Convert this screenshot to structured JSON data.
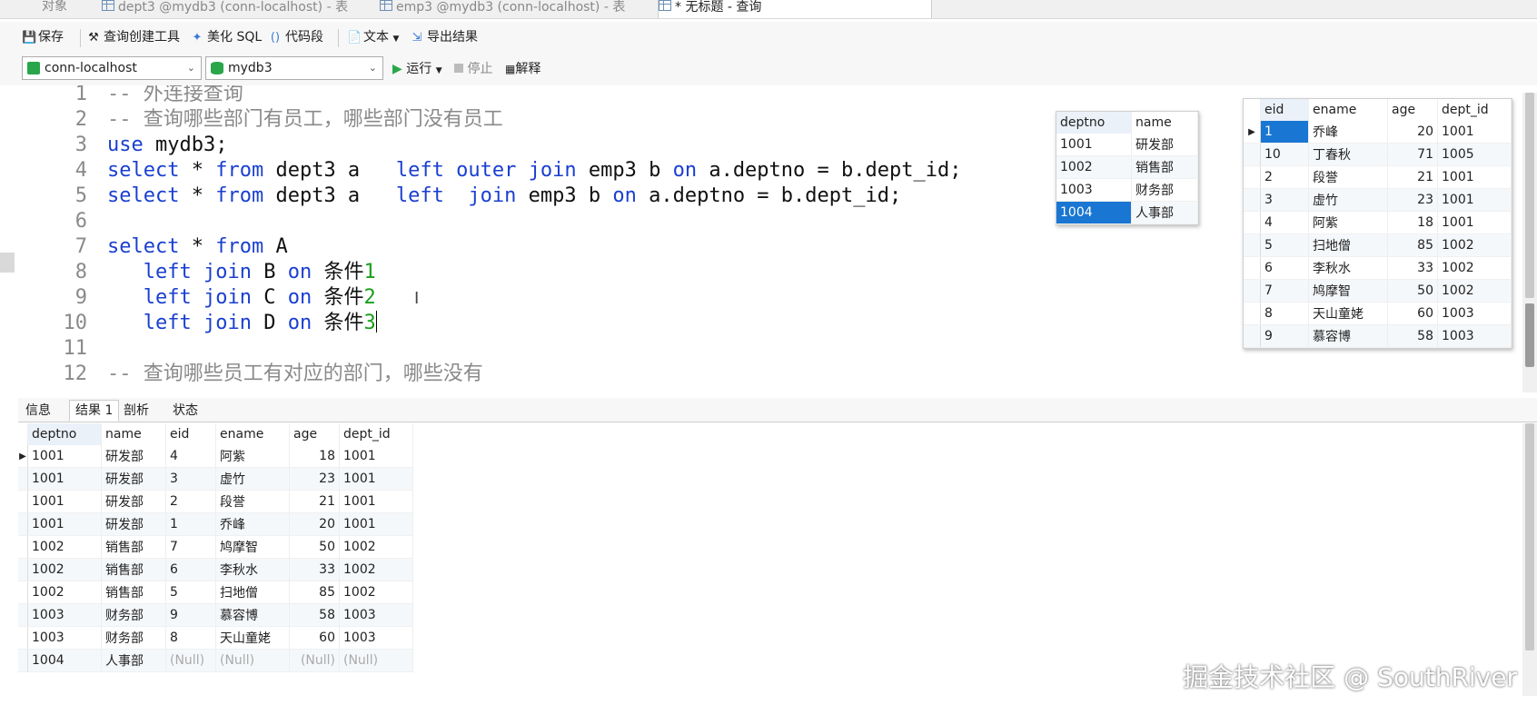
{
  "tabs": [
    {
      "label": "对象",
      "active": false
    },
    {
      "label": "dept3 @mydb3 (conn-localhost) - 表",
      "active": false
    },
    {
      "label": "emp3 @mydb3 (conn-localhost) - 表",
      "active": false
    },
    {
      "label": "* 无标题 - 查询",
      "active": true
    }
  ],
  "toolbar": {
    "save": "保存",
    "query_builder": "查询创建工具",
    "beautify": "美化 SQL",
    "snippet": "代码段",
    "text": "文本",
    "export": "导出结果"
  },
  "connection": {
    "conn": "conn-localhost",
    "db": "mydb3",
    "run": "运行",
    "stop": "停止",
    "explain": "解释"
  },
  "editor": {
    "line_numbers": [
      "1",
      "2",
      "3",
      "4",
      "5",
      "6",
      "7",
      "8",
      "9",
      "10",
      "11",
      "12"
    ]
  },
  "dept_grid": {
    "columns": [
      "deptno",
      "name"
    ],
    "rows": [
      [
        "1001",
        "研发部"
      ],
      [
        "1002",
        "销售部"
      ],
      [
        "1003",
        "财务部"
      ],
      [
        "1004",
        "人事部"
      ]
    ]
  },
  "emp_grid": {
    "columns": [
      "eid",
      "ename",
      "age",
      "dept_id"
    ],
    "rows": [
      [
        "1",
        "乔峰",
        "20",
        "1001"
      ],
      [
        "10",
        "丁春秋",
        "71",
        "1005"
      ],
      [
        "2",
        "段誉",
        "21",
        "1001"
      ],
      [
        "3",
        "虚竹",
        "23",
        "1001"
      ],
      [
        "4",
        "阿紫",
        "18",
        "1001"
      ],
      [
        "5",
        "扫地僧",
        "85",
        "1002"
      ],
      [
        "6",
        "李秋水",
        "33",
        "1002"
      ],
      [
        "7",
        "鸠摩智",
        "50",
        "1002"
      ],
      [
        "8",
        "天山童姥",
        "60",
        "1003"
      ],
      [
        "9",
        "慕容博",
        "58",
        "1003"
      ]
    ]
  },
  "result_tabs": [
    "信息",
    "结果 1",
    "剖析",
    "状态"
  ],
  "result_grid": {
    "columns": [
      "deptno",
      "name",
      "eid",
      "ename",
      "age",
      "dept_id"
    ],
    "rows": [
      [
        "1001",
        "研发部",
        "4",
        "阿紫",
        "18",
        "1001"
      ],
      [
        "1001",
        "研发部",
        "3",
        "虚竹",
        "23",
        "1001"
      ],
      [
        "1001",
        "研发部",
        "2",
        "段誉",
        "21",
        "1001"
      ],
      [
        "1001",
        "研发部",
        "1",
        "乔峰",
        "20",
        "1001"
      ],
      [
        "1002",
        "销售部",
        "7",
        "鸠摩智",
        "50",
        "1002"
      ],
      [
        "1002",
        "销售部",
        "6",
        "李秋水",
        "33",
        "1002"
      ],
      [
        "1002",
        "销售部",
        "5",
        "扫地僧",
        "85",
        "1002"
      ],
      [
        "1003",
        "财务部",
        "9",
        "慕容博",
        "58",
        "1003"
      ],
      [
        "1003",
        "财务部",
        "8",
        "天山童姥",
        "60",
        "1003"
      ],
      [
        "1004",
        "人事部",
        "(Null)",
        "(Null)",
        "(Null)",
        "(Null)"
      ]
    ]
  },
  "watermark": "掘金技术社区 @ SouthRiver"
}
